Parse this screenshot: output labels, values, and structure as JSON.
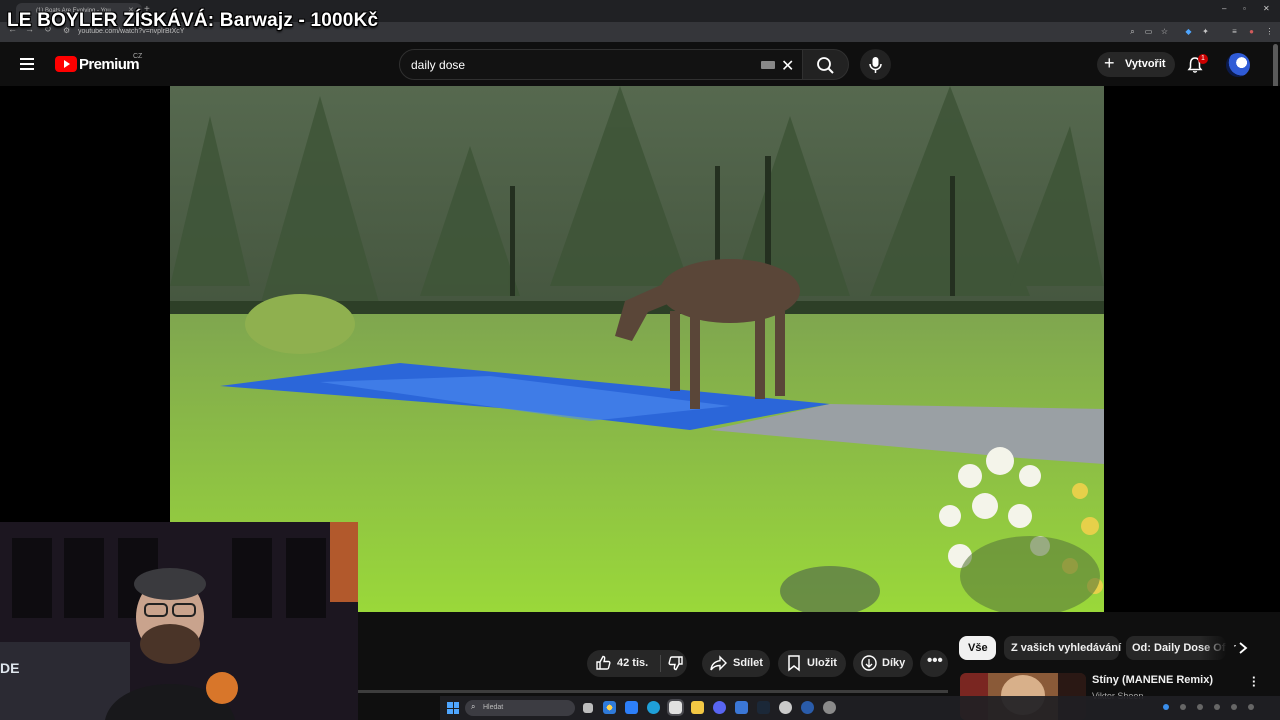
{
  "overlay": {
    "title": "LE BOYLER ZÍSKÁVÁ: Barwajz - 1000Kč"
  },
  "browser": {
    "tab_title": "(1) Boats Are Evolving - You",
    "url": "youtube.com/watch?v=nvplrBtXcY"
  },
  "header": {
    "logo_text": "Premium",
    "country_code": "CZ",
    "search_value": "daily dose",
    "create_label": "Vytvořit",
    "notification_count": "1"
  },
  "webcam": {
    "partial_label": "DE"
  },
  "actions": {
    "like_count": "42 tis.",
    "share_label": "Sdílet",
    "save_label": "Uložit",
    "thanks_label": "Díky"
  },
  "chips": [
    {
      "label": "Vše",
      "active": true
    },
    {
      "label": "Z vašich vyhledávání",
      "active": false
    },
    {
      "label": "Od: Daily Dose Of Ir",
      "active": false
    }
  ],
  "recommendation": {
    "title": "Stíny (MANENE Remix)",
    "channel": "Viktor Sheen"
  },
  "taskbar": {
    "search_placeholder": "Hledat"
  },
  "colors": {
    "brand_red": "#ff0000",
    "accent_blue": "#4fa6ff",
    "background": "#0f0f0f"
  }
}
